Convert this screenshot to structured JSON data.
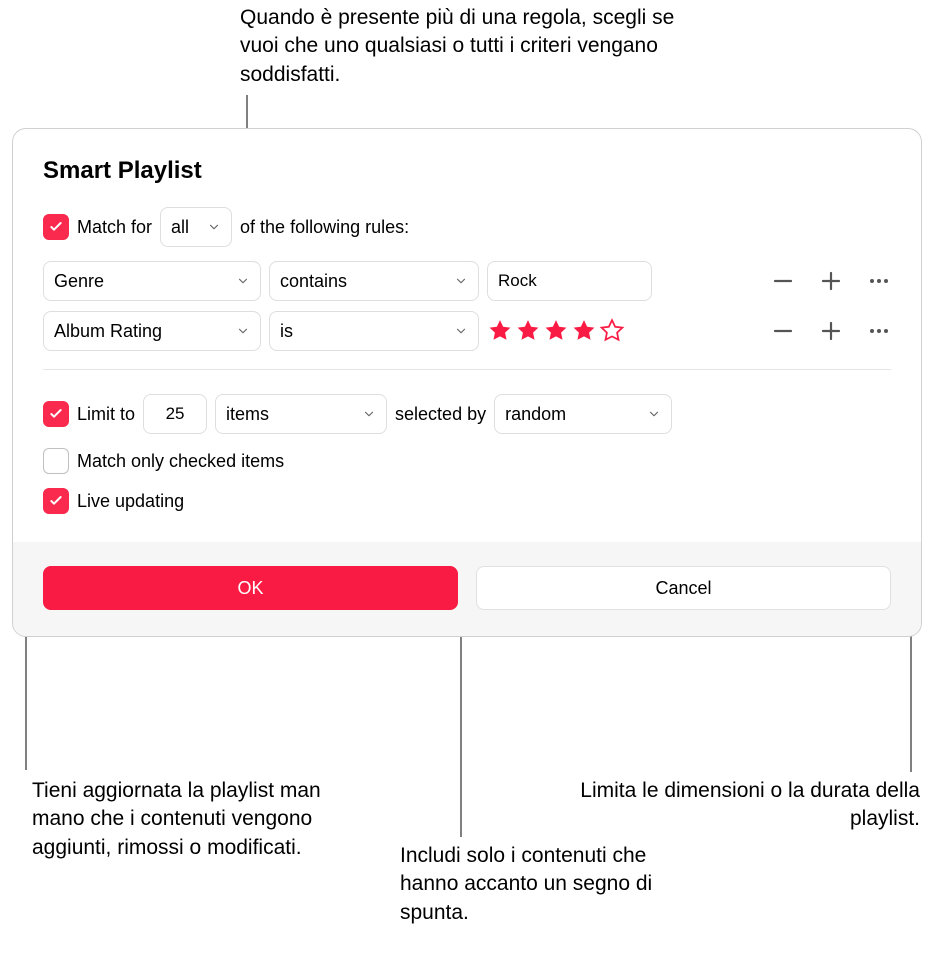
{
  "callouts": {
    "top": "Quando è presente più di una regola, scegli se vuoi che uno qualsiasi o tutti i criteri vengano soddisfatti.",
    "bottom_left": "Tieni aggiornata la playlist man mano che i contenuti vengono aggiunti, rimossi o modificati.",
    "bottom_mid": "Includi solo i contenuti che hanno accanto un segno di spunta.",
    "bottom_right": "Limita le dimensioni o la durata della playlist."
  },
  "dialog": {
    "title": "Smart Playlist",
    "match": {
      "prefix": "Match for",
      "mode": "all",
      "suffix": "of the following rules:"
    },
    "rules": [
      {
        "field": "Genre",
        "op": "contains",
        "value": "Rock",
        "type": "text"
      },
      {
        "field": "Album Rating",
        "op": "is",
        "stars_filled": 4,
        "stars_total": 5,
        "type": "stars"
      }
    ],
    "limit": {
      "enabled": true,
      "prefix": "Limit to",
      "value": "25",
      "unit": "items",
      "selected_by_label": "selected by",
      "selected_by": "random"
    },
    "match_checked": {
      "enabled": false,
      "label": "Match only checked items"
    },
    "live_updating": {
      "enabled": true,
      "label": "Live updating"
    },
    "buttons": {
      "ok": "OK",
      "cancel": "Cancel"
    }
  },
  "colors": {
    "accent": "#f91b44",
    "checkbox": "#f92a4d"
  }
}
